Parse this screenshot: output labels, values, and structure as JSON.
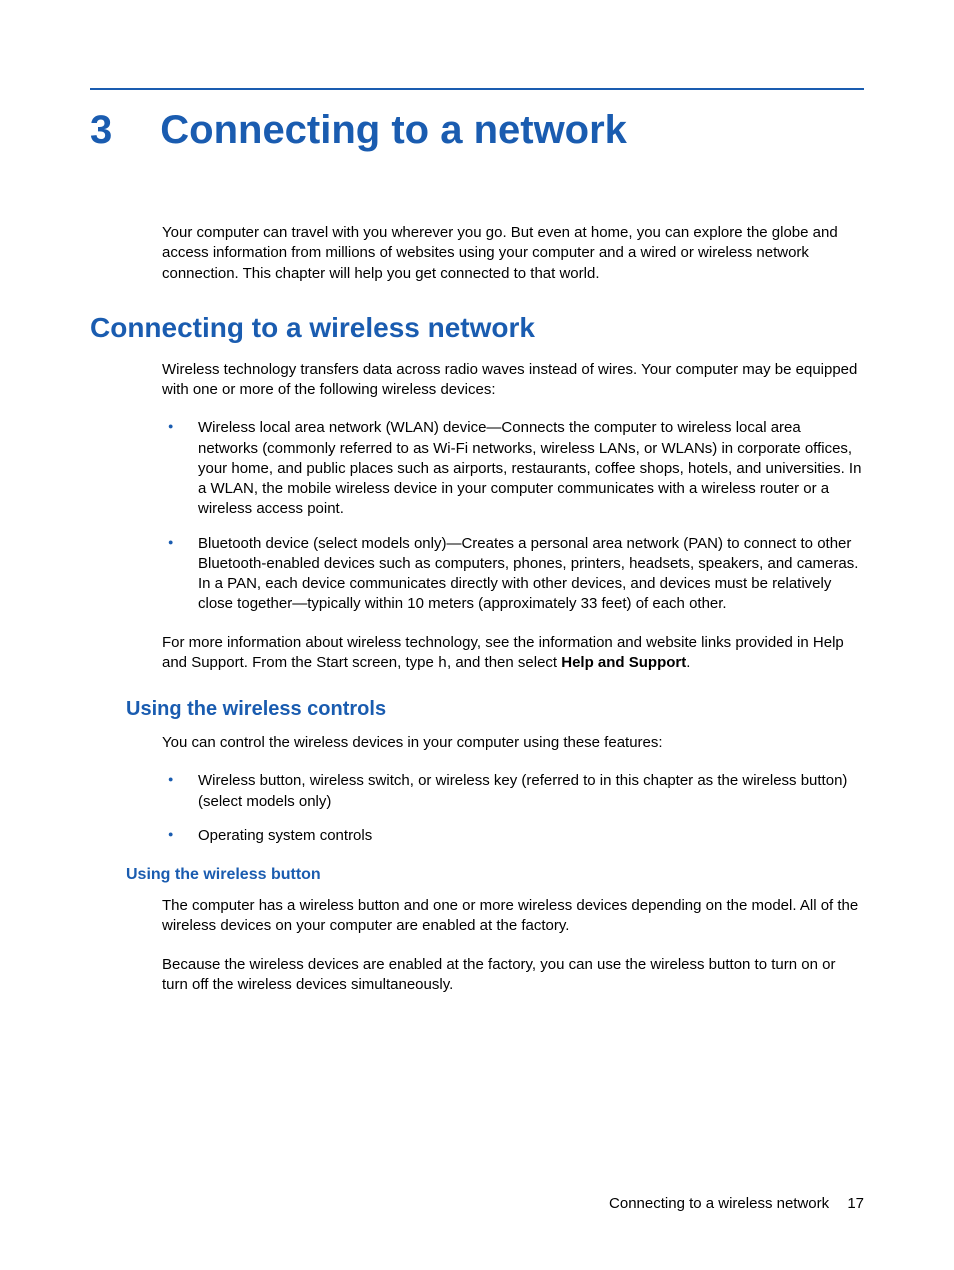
{
  "chapter": {
    "number": "3",
    "title": "Connecting to a network"
  },
  "intro_paragraph": "Your computer can travel with you wherever you go. But even at home, you can explore the globe and access information from millions of websites using your computer and a wired or wireless network connection. This chapter will help you get connected to that world.",
  "section1": {
    "heading": "Connecting to a wireless network",
    "paragraph1": "Wireless technology transfers data across radio waves instead of wires. Your computer may be equipped with one or more of the following wireless devices:",
    "bullets": [
      "Wireless local area network (WLAN) device—Connects the computer to wireless local area networks (commonly referred to as Wi-Fi networks, wireless LANs, or WLANs) in corporate offices, your home, and public places such as airports, restaurants, coffee shops, hotels, and universities. In a WLAN, the mobile wireless device in your computer communicates with a wireless router or a wireless access point.",
      "Bluetooth device (select models only)—Creates a personal area network (PAN) to connect to other Bluetooth-enabled devices such as computers, phones, printers, headsets, speakers, and cameras. In a PAN, each device communicates directly with other devices, and devices must be relatively close together—typically within 10 meters (approximately 33 feet) of each other."
    ],
    "paragraph2_pre": "For more information about wireless technology, see the information and website links provided in Help and Support. From the Start screen, type ",
    "paragraph2_mono": "h",
    "paragraph2_mid": ", and then select ",
    "paragraph2_bold": "Help and Support",
    "paragraph2_end": "."
  },
  "section2": {
    "heading": "Using the wireless controls",
    "paragraph": "You can control the wireless devices in your computer using these features:",
    "bullets": [
      "Wireless button, wireless switch, or wireless key (referred to in this chapter as the wireless button) (select models only)",
      "Operating system controls"
    ]
  },
  "section3": {
    "heading": "Using the wireless button",
    "paragraph1": "The computer has a wireless button and one or more wireless devices depending on the model. All of the wireless devices on your computer are enabled at the factory.",
    "paragraph2": "Because the wireless devices are enabled at the factory, you can use the wireless button to turn on or turn off the wireless devices simultaneously."
  },
  "footer": {
    "text": "Connecting to a wireless network",
    "page": "17"
  }
}
